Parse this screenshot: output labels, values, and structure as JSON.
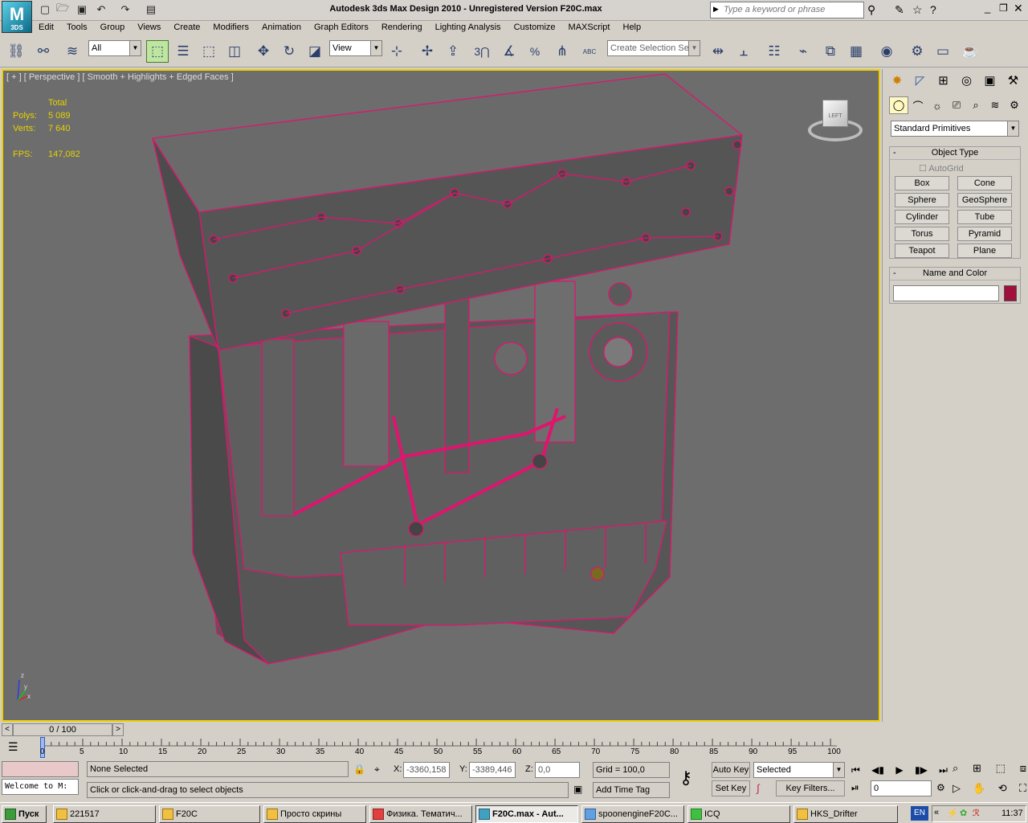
{
  "app": {
    "title": "Autodesk 3ds Max Design 2010  - Unregistered Version     F20C.max",
    "logo_text": "M",
    "logo_sub": "3DS"
  },
  "quick_access": {
    "icons": [
      "new-icon",
      "open-icon",
      "save-icon",
      "undo-icon",
      "redo-icon",
      "project-icon"
    ]
  },
  "search": {
    "placeholder": "Type a keyword or phrase"
  },
  "menu": [
    "Edit",
    "Tools",
    "Group",
    "Views",
    "Create",
    "Modifiers",
    "Animation",
    "Graph Editors",
    "Rendering",
    "Lighting Analysis",
    "Customize",
    "MAXScript",
    "Help"
  ],
  "toolbar": {
    "filter": "All",
    "ref_coord": "View",
    "selection_set_placeholder": "Create Selection Se",
    "snap_value": "3",
    "percent_label": "%",
    "abc_label": "ABC"
  },
  "viewport": {
    "label": "[ + ] [ Perspective ] [ Smooth + Highlights + Edged Faces ]",
    "stats_header": "Total",
    "polys_label": "Polys:",
    "polys_value": "5 089",
    "verts_label": "Verts:",
    "verts_value": "7 640",
    "fps_label": "FPS:",
    "fps_value": "147,082",
    "viewcube_label": "LEFT",
    "axis_z": "z",
    "axis_x": "x",
    "axis_y": "y"
  },
  "command_panel": {
    "category": "Standard Primitives",
    "object_type_title": "Object Type",
    "autogrid": "AutoGrid",
    "buttons": [
      "Box",
      "Cone",
      "Sphere",
      "GeoSphere",
      "Cylinder",
      "Tube",
      "Torus",
      "Pyramid",
      "Teapot",
      "Plane"
    ],
    "name_color_title": "Name and Color",
    "name_value": "",
    "swatch_color": "#a0103c"
  },
  "time": {
    "slider_label": "0 / 100",
    "ticks": [
      "0",
      "5",
      "10",
      "15",
      "20",
      "25",
      "30",
      "35",
      "40",
      "45",
      "50",
      "55",
      "60",
      "65",
      "70",
      "75",
      "80",
      "85",
      "90",
      "95",
      "100"
    ]
  },
  "status": {
    "selection": "None Selected",
    "prompt": "Click or click-and-drag to select objects",
    "maxscript": "Welcome to M:",
    "x_label": "X:",
    "x_value": "-3360,158",
    "y_label": "Y:",
    "y_value": "-3389,446",
    "z_label": "Z:",
    "z_value": "0,0",
    "grid": "Grid = 100,0",
    "add_time_tag": "Add Time Tag",
    "auto_key": "Auto Key",
    "set_key": "Set Key",
    "key_mode": "Selected",
    "key_filters": "Key Filters...",
    "frame": "0"
  },
  "taskbar": {
    "start": "Пуск",
    "tasks": [
      "221517",
      "F20C",
      "Просто скрины",
      "Физика. Тематич...",
      "F20C.max - Aut...",
      "spoonengineF20C...",
      "ICQ",
      "HKS_Drifter"
    ],
    "lang": "EN",
    "clock": "11:37"
  },
  "colors": {
    "wire": "#e0146e",
    "accent": "#f0d000",
    "stats": "#e6d200",
    "viewport_bg": "#6d6d6d"
  }
}
